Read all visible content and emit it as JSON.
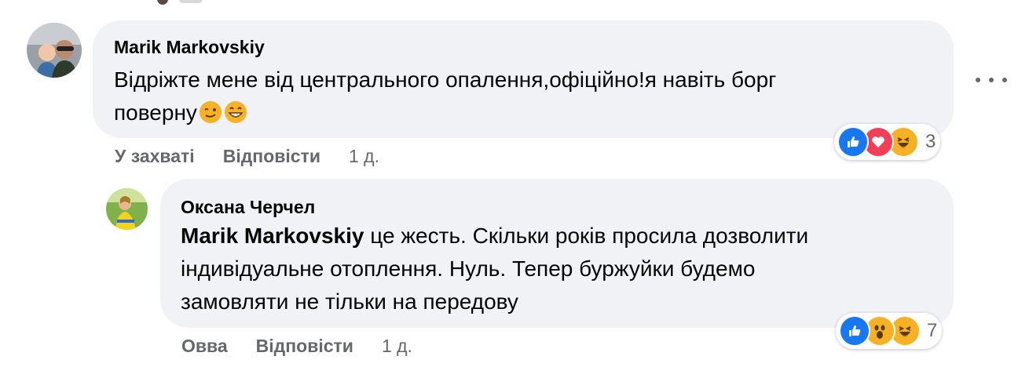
{
  "comments": [
    {
      "author": "Marik Markovskiy",
      "text_line1": "Відріжте мене від центрального опалення,офіційно!я навіть борг",
      "text_line2": "поверну",
      "emojis": [
        "wink-emoji",
        "grin-emoji"
      ],
      "reaction_icons": [
        "like-icon",
        "love-icon",
        "haha-icon"
      ],
      "reaction_count": "3",
      "actions": {
        "react_label": "У захваті",
        "reply_label": "Відповісти",
        "time": "1 д."
      }
    },
    {
      "author": "Оксана Черчел",
      "mention": "Marik Markovskiy",
      "text_line1": " це жесть. Скільки років просила дозволити",
      "text_line2": "індивідуальне отоплення. Нуль. Тепер буржуйки будемо",
      "text_line3": "замовляти не тільки на передову",
      "reaction_icons": [
        "like-icon",
        "wow-icon",
        "haha-icon"
      ],
      "reaction_count": "7",
      "actions": {
        "react_label": "Овва",
        "reply_label": "Відповісти",
        "time": "1 д."
      }
    }
  ],
  "colors": {
    "bubble": "#f0f2f5",
    "meta_text": "#65676b",
    "like": "#1877f2",
    "love": "#f33e58",
    "emoji_yellow": "#f7b125"
  }
}
